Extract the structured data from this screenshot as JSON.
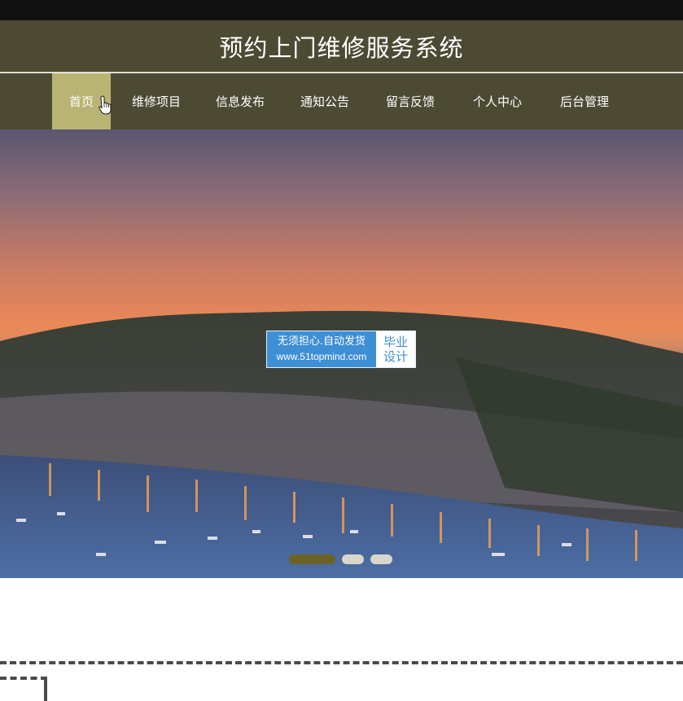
{
  "header": {
    "site_title": "预约上门维修服务系统"
  },
  "nav": {
    "items": [
      {
        "label": "首页",
        "active": true
      },
      {
        "label": "维修项目"
      },
      {
        "label": "信息发布"
      },
      {
        "label": "通知公告"
      },
      {
        "label": "留言反馈"
      },
      {
        "label": "个人中心"
      },
      {
        "label": "后台管理"
      }
    ]
  },
  "banner": {
    "slide_count": 3,
    "active_slide": 1,
    "watermark": {
      "line1": "无须担心.自动发货",
      "line2": "www.51topmind.com",
      "badge_line1": "毕业",
      "badge_line2": "设计"
    }
  },
  "colors": {
    "header_bg": "#4d4a34",
    "nav_active_bg": "#b9b474",
    "indicator_active": "#6b6325",
    "watermark_blue": "#3d8fd6"
  }
}
